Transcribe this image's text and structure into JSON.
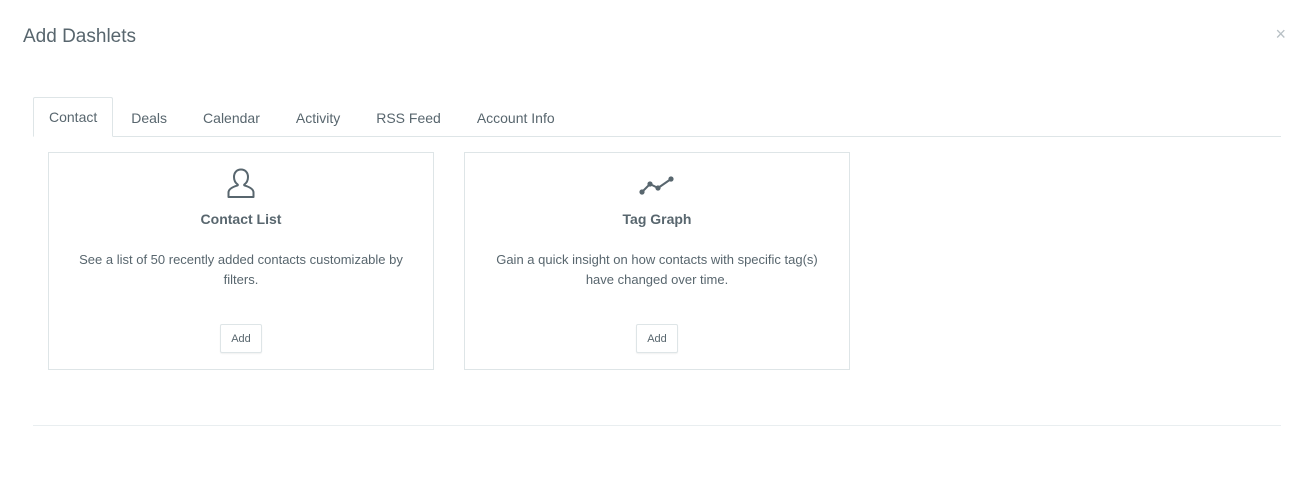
{
  "modal": {
    "title": "Add Dashlets",
    "close_label": "×"
  },
  "tabs": [
    {
      "label": "Contact",
      "active": true
    },
    {
      "label": "Deals",
      "active": false
    },
    {
      "label": "Calendar",
      "active": false
    },
    {
      "label": "Activity",
      "active": false
    },
    {
      "label": "RSS Feed",
      "active": false
    },
    {
      "label": "Account Info",
      "active": false
    }
  ],
  "dashlets": [
    {
      "icon": "user-icon",
      "title": "Contact List",
      "description": "See a list of 50 recently added contacts customizable by filters.",
      "button_label": "Add"
    },
    {
      "icon": "line-graph-icon",
      "title": "Tag Graph",
      "description": "Gain a quick insight on how contacts with specific tag(s) have changed over time.",
      "button_label": "Add"
    }
  ],
  "colors": {
    "text": "#58666e",
    "border": "#dee5e7",
    "close": "#b8c0c5"
  }
}
